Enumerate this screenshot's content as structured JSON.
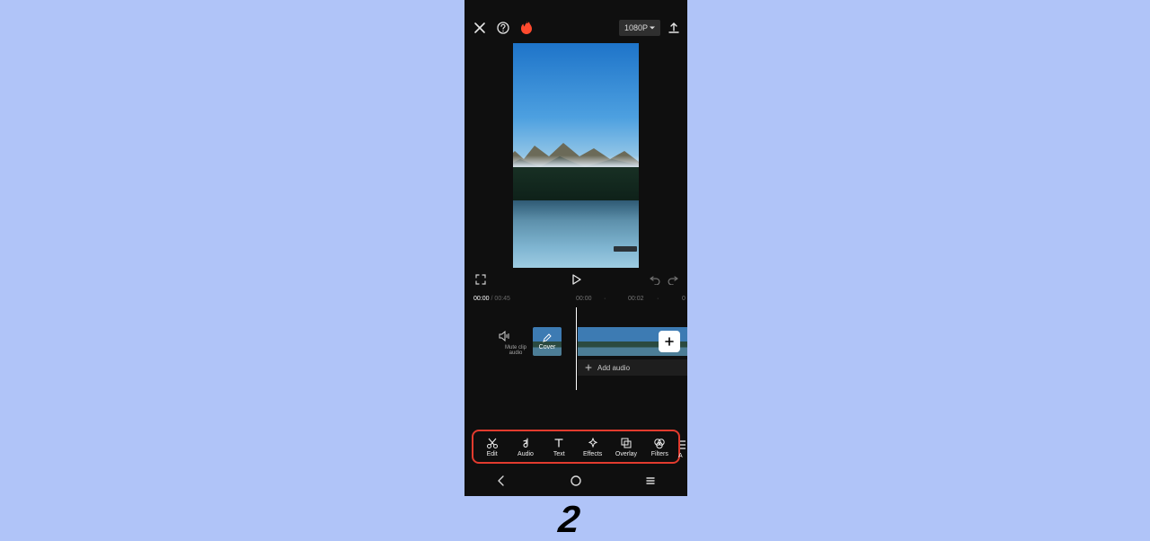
{
  "step_number": "2",
  "topbar": {
    "resolution_label": "1080P"
  },
  "preview": {
    "current_time": "00:00",
    "duration": "00:45"
  },
  "timeline": {
    "ticks": [
      "00:00",
      "00:02"
    ],
    "mute_label": "Mute clip audio",
    "cover_label": "Cover",
    "add_audio_label": "Add audio"
  },
  "tools": [
    {
      "id": "edit",
      "label": "Edit"
    },
    {
      "id": "audio",
      "label": "Audio"
    },
    {
      "id": "text",
      "label": "Text"
    },
    {
      "id": "effects",
      "label": "Effects"
    },
    {
      "id": "overlay",
      "label": "Overlay"
    },
    {
      "id": "filters",
      "label": "Filters"
    }
  ],
  "peek_tool_label": "A",
  "colors": {
    "page_bg": "#b0c4f8",
    "highlight_border": "#e23b2e"
  }
}
